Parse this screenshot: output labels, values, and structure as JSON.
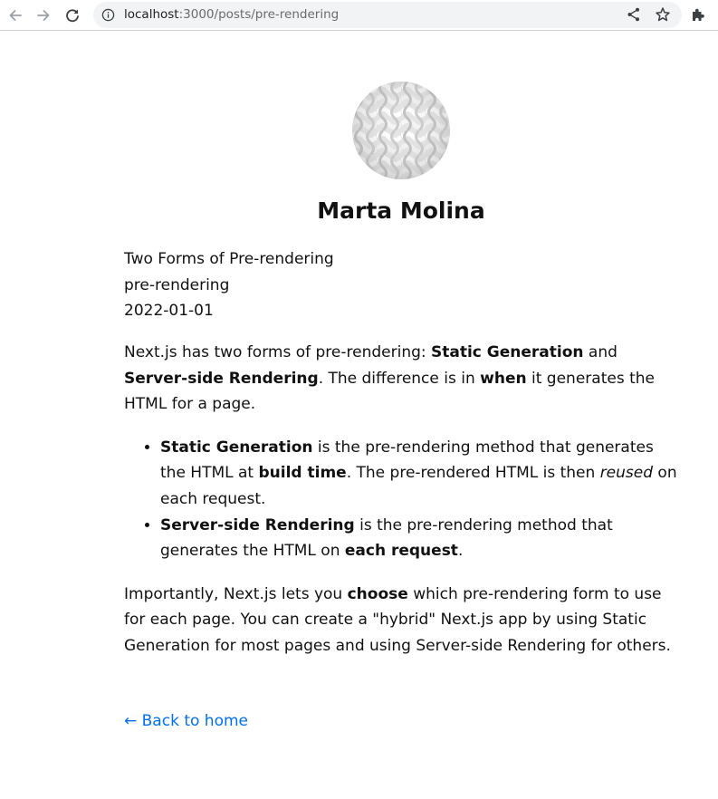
{
  "browser": {
    "url_host": "localhost",
    "url_path": ":3000/posts/pre-rendering",
    "icons": {
      "back": "arrow-left-icon",
      "forward": "arrow-right-icon",
      "reload": "reload-icon",
      "info": "info-icon",
      "share": "share-icon",
      "bookmark": "star-icon",
      "extensions": "puzzle-icon"
    }
  },
  "header": {
    "name": "Marta Molina"
  },
  "post": {
    "title": "Two Forms of Pre-rendering",
    "id": "pre-rendering",
    "date": "2022-01-01",
    "p1": {
      "t1": "Next.js has two forms of pre-rendering: ",
      "b1": "Static Generation",
      "t2": " and ",
      "b2": "Server-side Rendering",
      "t3": ". The difference is in ",
      "b3": "when",
      "t4": " it generates the HTML for a page."
    },
    "list": [
      {
        "b1": "Static Generation",
        "t1": " is the pre-rendering method that generates the HTML at ",
        "b2": "build time",
        "t2": ". The pre-rendered HTML is then ",
        "i1": "reused",
        "t3": " on each request."
      },
      {
        "b1": "Server-side Rendering",
        "t1": " is the pre-rendering method that generates the HTML on ",
        "b2": "each request",
        "t2": "."
      }
    ],
    "p2": {
      "t1": "Importantly, Next.js lets you ",
      "b1": "choose",
      "t2": " which pre-rendering form to use for each page. You can create a \"hybrid\" Next.js app by using Static Generation for most pages and using Server-side Rendering for others."
    }
  },
  "footer": {
    "back_link": "← Back to home"
  },
  "colors": {
    "link": "#0070f3",
    "text": "#111111",
    "omnibox_bg": "#f1f3f4"
  }
}
